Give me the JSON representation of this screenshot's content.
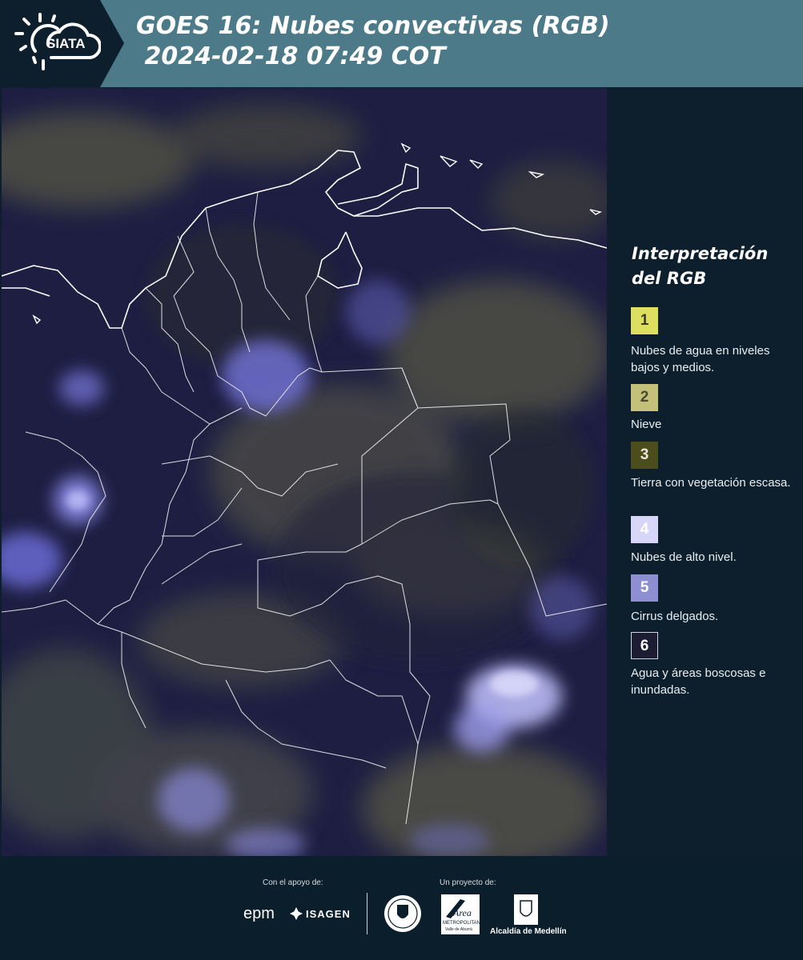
{
  "header": {
    "logo_text": "SIATA",
    "title_line1": "GOES 16: Nubes convectivas (RGB)",
    "title_line2": " 2024-02-18 07:49 COT"
  },
  "legend": {
    "title": "Interpretación del RGB",
    "items": [
      {
        "number": "1",
        "label": "Nubes de agua en niveles bajos y medios.",
        "color": "#dede60"
      },
      {
        "number": "2",
        "label": "Nieve",
        "color": "#c3c07a"
      },
      {
        "number": "3",
        "label": "Tierra con vegetación escasa.",
        "color": "#4c4d1c"
      },
      {
        "number": "4",
        "label": "Nubes de alto nivel.",
        "color": "#d8d6f8"
      },
      {
        "number": "5",
        "label": "Cirrus delgados.",
        "color": "#8e8ed2"
      },
      {
        "number": "6",
        "label": "Agua y áreas boscosas e inundadas.",
        "color": "#1c1c32"
      }
    ]
  },
  "footer": {
    "support_label": "Con el apoyo de:",
    "project_label": "Un proyecto de:",
    "logo_epm": "epm",
    "logo_isagen": "ISAGEN",
    "logo_area": "Área",
    "logo_area_sub": "METROPOLITANA",
    "logo_area_sub2": "Valle de Aburrá",
    "logo_alcaldia": "Alcaldía de Medellín"
  },
  "colors": {
    "header_bg": "#4c7a88",
    "header_dark": "#0d1f2d",
    "panel_bg": "#0d1f2d",
    "map_water": "#191a3b",
    "border_lines": "#ffffff"
  }
}
